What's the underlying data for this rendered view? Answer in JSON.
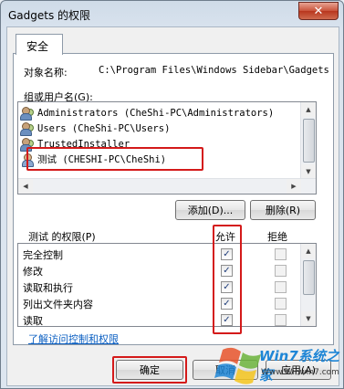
{
  "window": {
    "title": "Gadgets 的权限",
    "close_glyph": "✕"
  },
  "tab": {
    "label": "安全"
  },
  "object": {
    "label": "对象名称:",
    "value": "C:\\Program Files\\Windows Sidebar\\Gadgets"
  },
  "groups": {
    "label": "组或用户名(G):",
    "items": [
      {
        "label": "Administrators (CheShi-PC\\Administrators)",
        "icon": "users-group-icon"
      },
      {
        "label": "Users (CheShi-PC\\Users)",
        "icon": "users-group-icon"
      },
      {
        "label": "TrustedInstaller",
        "icon": "users-group-icon"
      },
      {
        "label": "测试 (CHESHI-PC\\CheShi)",
        "icon": "user-icon"
      }
    ]
  },
  "buttons": {
    "add": "添加(D)...",
    "remove": "删除(R)",
    "ok": "确定",
    "cancel": "取消",
    "apply": "应用(A)"
  },
  "permissions": {
    "label": "测试 的权限(P)",
    "allow_header": "允许",
    "deny_header": "拒绝",
    "check_glyph": "✓",
    "rows": [
      {
        "name": "完全控制",
        "allow": true,
        "deny": false
      },
      {
        "name": "修改",
        "allow": true,
        "deny": false
      },
      {
        "name": "读取和执行",
        "allow": true,
        "deny": false
      },
      {
        "name": "列出文件夹内容",
        "allow": true,
        "deny": false
      },
      {
        "name": "读取",
        "allow": true,
        "deny": false
      }
    ]
  },
  "link": "了解访问控制和权限",
  "watermark": {
    "brand": "Win7系统之家",
    "url": "Www.Winwin7.com"
  },
  "colors": {
    "highlight": "#d41a1a",
    "link": "#0b5fc2"
  }
}
